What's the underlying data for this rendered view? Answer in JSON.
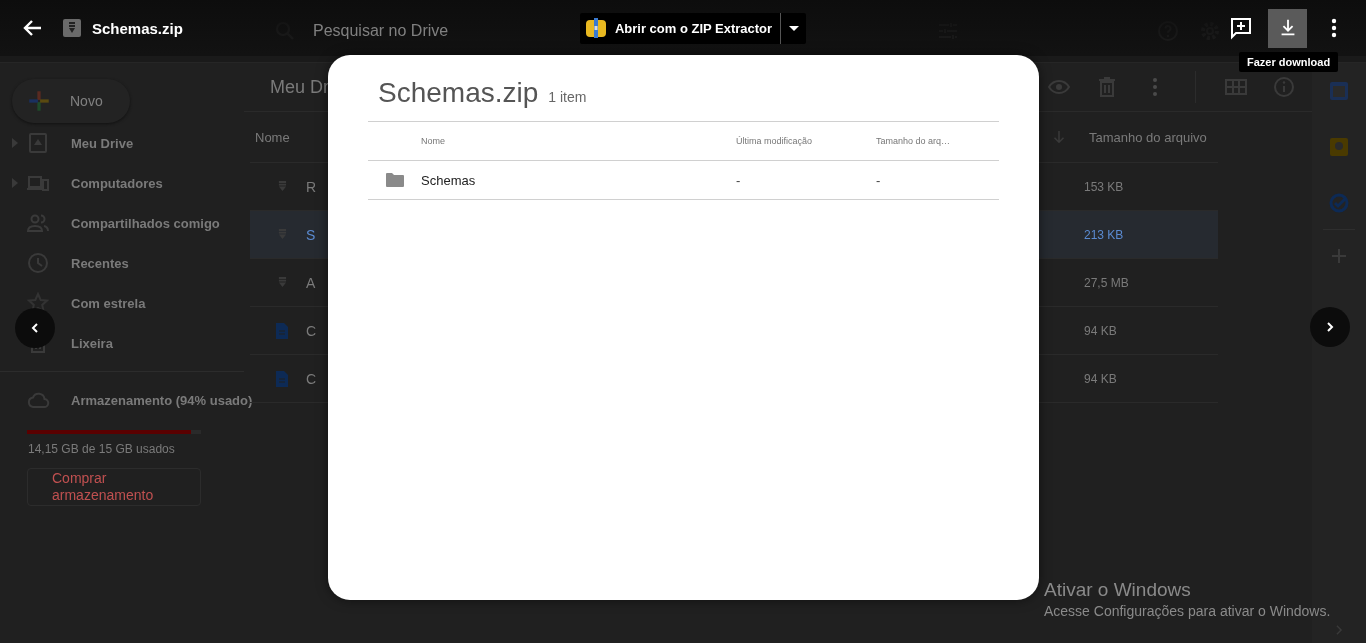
{
  "viewer_bar": {
    "title": "Schemas.zip",
    "open_with_button": "Abrir com o ZIP Extractor",
    "tooltip": "Fazer download"
  },
  "drive_header": {
    "search": {
      "placeholder": "Pesquisar no Drive"
    }
  },
  "sidebar": {
    "new_button": "Novo",
    "items": [
      {
        "kind": "drive",
        "label": "Meu Drive",
        "expandable": true
      },
      {
        "kind": "computers",
        "label": "Computadores",
        "expandable": true
      },
      {
        "kind": "shared",
        "label": "Compartilhados comigo",
        "expandable": false
      },
      {
        "kind": "recent",
        "label": "Recentes",
        "expandable": false
      },
      {
        "kind": "starred",
        "label": "Com estrela",
        "expandable": false
      },
      {
        "kind": "trash",
        "label": "Lixeira",
        "expandable": false
      }
    ],
    "storage": {
      "label": "Armazenamento (94% usado)",
      "level": 0.94,
      "usage": "14,15 GB de 15 GB usados",
      "buy_button": "Comprar armazenamento"
    }
  },
  "file_list": {
    "breadcrumb": "Meu Dr",
    "columns": [
      "Nome",
      "Tamanho do arquivo"
    ],
    "rows": [
      {
        "kind": "zip",
        "name": "R",
        "size": "153 KB",
        "selected": false
      },
      {
        "kind": "zip",
        "name": "S",
        "size": "213 KB",
        "selected": true
      },
      {
        "kind": "zip",
        "name": "A",
        "size": "27,5 MB",
        "selected": false
      },
      {
        "kind": "doc",
        "name": "C",
        "size": "94 KB",
        "selected": false
      },
      {
        "kind": "doc",
        "name": "C",
        "size": "94 KB",
        "selected": false
      }
    ]
  },
  "zip_preview": {
    "title": "Schemas.zip",
    "count": "1 item",
    "columns": [
      "Nome",
      "Última modificação",
      "Tamanho do arq…"
    ],
    "rows": [
      {
        "kind": "folder",
        "name": "Schemas",
        "modified": "-",
        "size": "-"
      }
    ]
  },
  "windows_notice": {
    "title": "Ativar o Windows",
    "text": "Acesse Configurações para ativar o Windows."
  }
}
